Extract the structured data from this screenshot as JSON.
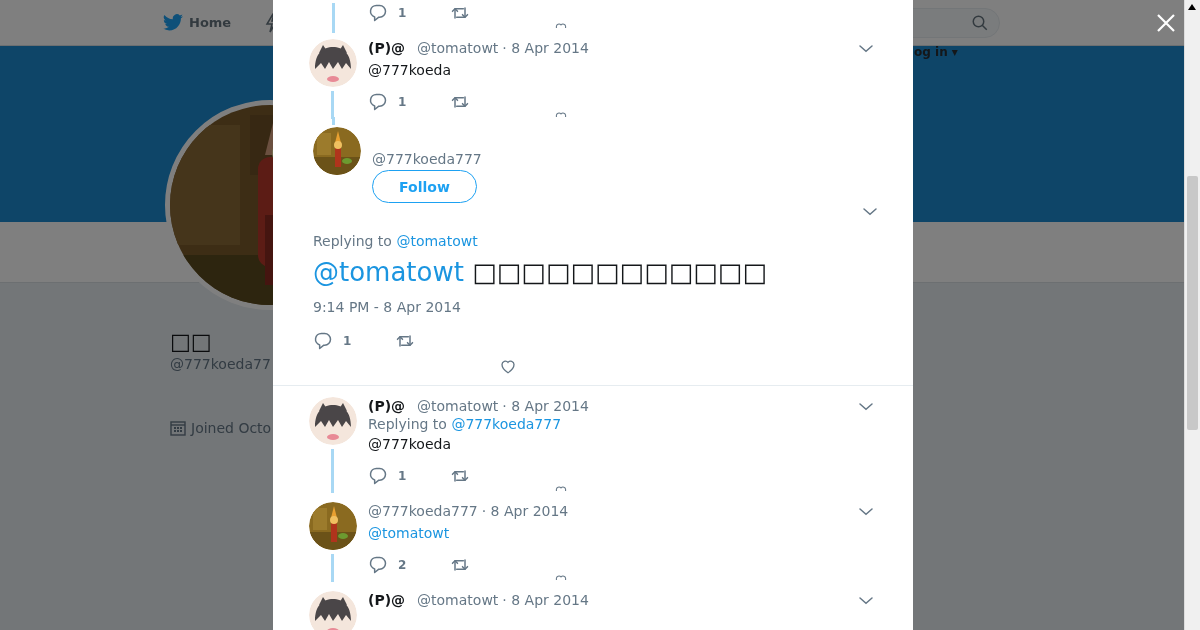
{
  "top_nav": {
    "home": "Home"
  },
  "login": "og in ▾",
  "profile": {
    "name": "□□",
    "handle": "@777koeda77",
    "joined": "Joined Octo"
  },
  "thread": [
    {
      "kind": "tail",
      "replies": "1"
    },
    {
      "kind": "reply",
      "avatar_photo": false,
      "name": "(P)@",
      "handle": "@tomatowt",
      "date": "· 8 Apr 2014",
      "text": "@777koeda",
      "text_is_link": false,
      "replies": "1",
      "thread_below": true
    },
    {
      "kind": "focus",
      "avatar_photo": true,
      "handle": "@777koeda777",
      "follow": "Follow",
      "replying_label": "Replying to",
      "replying_to": "@tomatowt",
      "mention": "@tomatowt",
      "text": "□□□□□□□□□□□□",
      "timestamp": "9:14 PM - 8 Apr 2014",
      "replies": "1"
    },
    {
      "kind": "reply",
      "avatar_photo": false,
      "name": "(P)@",
      "handle": "@tomatowt",
      "date": "· 8 Apr 2014",
      "replying_label": "Replying to",
      "replying_to": "@777koeda777",
      "text": "@777koeda",
      "text_is_link": false,
      "replies": "1",
      "thread_below": true
    },
    {
      "kind": "reply",
      "avatar_photo": true,
      "handle": "@777koeda777",
      "date": "· 8 Apr 2014",
      "text": "@tomatowt",
      "text_is_link": true,
      "replies": "2",
      "thread_below": true
    },
    {
      "kind": "cut",
      "avatar_photo": false,
      "name": "(P)@",
      "handle": "@tomatowt",
      "date": "· 8 Apr 2014"
    }
  ]
}
